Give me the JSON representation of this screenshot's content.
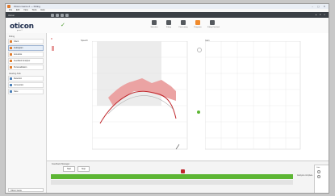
{
  "window": {
    "title": "Oticon Genie 2 — Fitting",
    "controls": "– ▢ ✕"
  },
  "menubar": [
    "File",
    "Edit",
    "View",
    "Tools",
    "Help"
  ],
  "darkbar": {
    "label": "Oticon",
    "right": "▲ ▼ ✕"
  },
  "brand": {
    "logo": "oticon",
    "subtitle": "genie 2"
  },
  "toolbar": {
    "items": [
      {
        "label": "Selection",
        "active": false
      },
      {
        "label": "Fitting",
        "active": false
      },
      {
        "label": "Fine-tuning",
        "active": false
      },
      {
        "label": "Programs",
        "active": true
      },
      {
        "label": "Fitting Finished",
        "active": false
      }
    ]
  },
  "sidebar": {
    "section1": "Fitting",
    "items1": [
      "Client",
      "Audiogram",
      "Acoustics",
      "Feedback Analyzer",
      "Personalization"
    ],
    "section2": "Hearing Aids",
    "items2": [
      "Detection",
      "Connection",
      "Save"
    ],
    "footer": "Oticon Genie"
  },
  "left_panel": {
    "legend": "R"
  },
  "left_graph": {
    "title": "Speech",
    "side_note": "Feedback margin"
  },
  "right_graph": {
    "title": "Gain"
  },
  "bottom": {
    "title": "Feedback Manager",
    "tabs": [
      "Start",
      "Stop"
    ],
    "status": "Analysis complete"
  },
  "side_options": {
    "title": "Side"
  },
  "colors": {
    "accent": "#f08a2c",
    "green": "#5db634",
    "red": "#c0282d",
    "speech_fill": "#eba3a3",
    "curve": "#c0282d"
  }
}
